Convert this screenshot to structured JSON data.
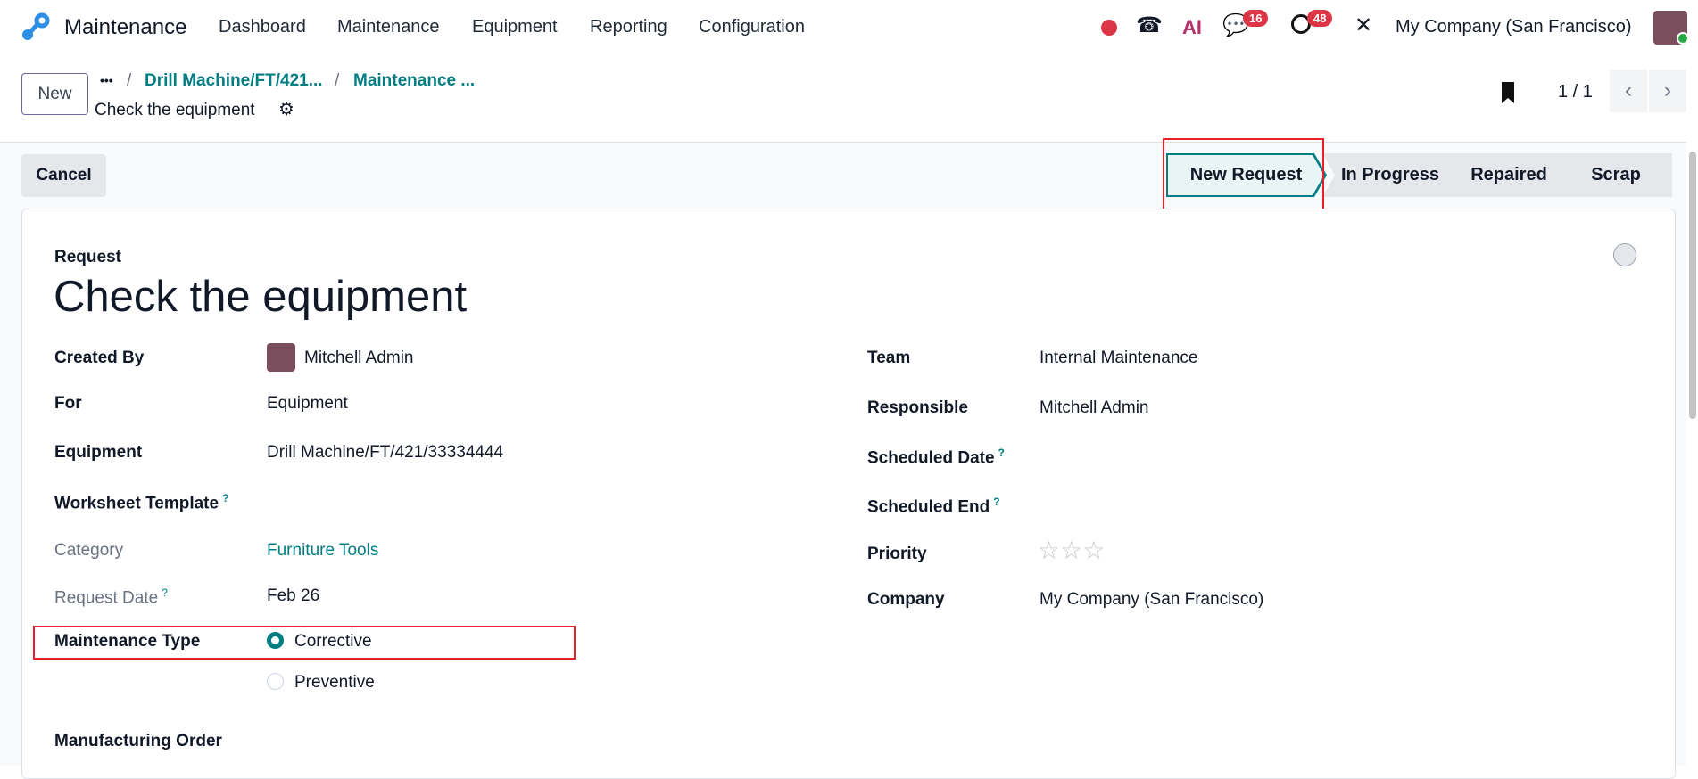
{
  "navbar": {
    "app_name": "Maintenance",
    "menu": [
      "Dashboard",
      "Maintenance",
      "Equipment",
      "Reporting",
      "Configuration"
    ],
    "chat_count": "16",
    "activity_count": "48",
    "company": "My Company (San Francisco)",
    "ai_label": "AI"
  },
  "control": {
    "new_label": "New",
    "breadcrumb": [
      "Drill Machine/FT/421...",
      "Maintenance ..."
    ],
    "ellipsis": "•••",
    "separator": "/",
    "record_title": "Check the equipment",
    "pager": "1 / 1",
    "cancel_label": "Cancel"
  },
  "stages": [
    "New Request",
    "In Progress",
    "Repaired",
    "Scrap"
  ],
  "form": {
    "subtitle": "Request",
    "title": "Check the equipment",
    "left": {
      "created_by_label": "Created By",
      "created_by": "Mitchell Admin",
      "for_label": "For",
      "for": "Equipment",
      "equipment_label": "Equipment",
      "equipment": "Drill Machine/FT/421/33334444",
      "worksheet_label": "Worksheet Template",
      "category_label": "Category",
      "category": "Furniture Tools",
      "request_date_label": "Request Date",
      "request_date": "Feb 26",
      "maintenance_type_label": "Maintenance Type",
      "type_options": [
        "Corrective",
        "Preventive"
      ],
      "mo_label": "Manufacturing Order"
    },
    "right": {
      "team_label": "Team",
      "team": "Internal Maintenance",
      "responsible_label": "Responsible",
      "responsible": "Mitchell Admin",
      "scheduled_date_label": "Scheduled Date",
      "scheduled_end_label": "Scheduled End",
      "priority_label": "Priority",
      "priority": 0,
      "company_label": "Company",
      "company": "My Company (San Francisco)"
    },
    "help_mark": "?"
  },
  "colors": {
    "accent": "#017e84",
    "highlight": "#e5202a",
    "badge": "#dc3545"
  }
}
